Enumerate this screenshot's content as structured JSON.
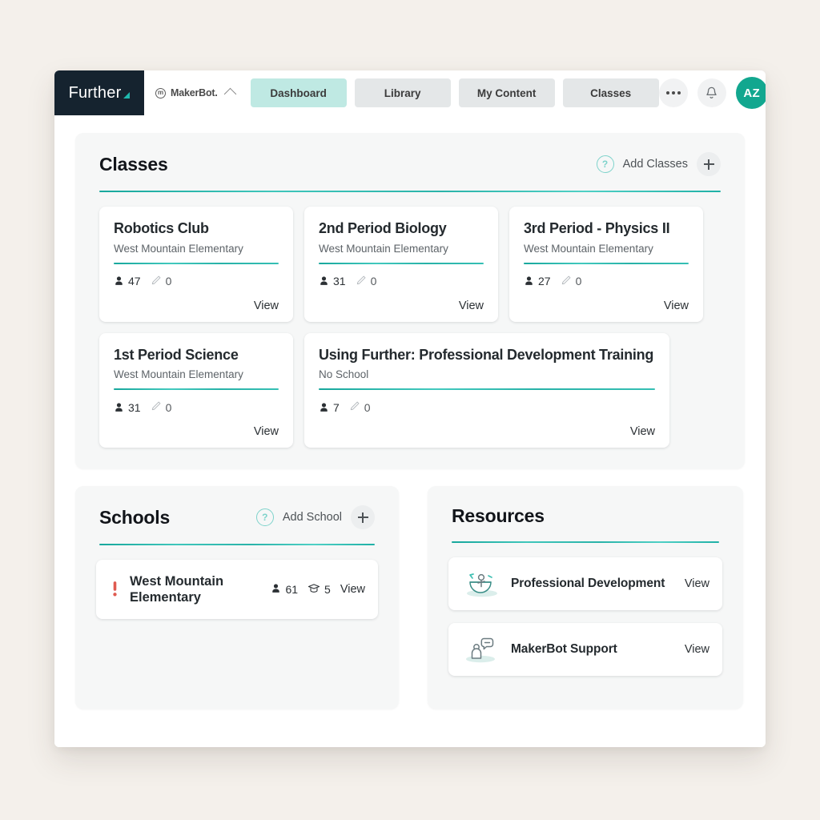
{
  "topnav": {
    "brand": "Further",
    "org": {
      "mark": "m",
      "name": "MakerBot.",
      "chevron": "chevron-up-icon"
    },
    "tabs": [
      {
        "label": "Dashboard",
        "active": true
      },
      {
        "label": "Library",
        "active": false
      },
      {
        "label": "My Content",
        "active": false
      },
      {
        "label": "Classes",
        "active": false
      }
    ],
    "more_icon": "more-dots-icon",
    "bell_icon": "bell-icon",
    "avatar_initials": "AZ"
  },
  "classes": {
    "title": "Classes",
    "help": "?",
    "add_label": "Add Classes",
    "view_label": "View",
    "cards": [
      {
        "name": "Robotics Club",
        "school": "West Mountain Elementary",
        "students": "47",
        "assignments": "0",
        "view": "View"
      },
      {
        "name": "2nd Period Biology",
        "school": "West Mountain Elementary",
        "students": "31",
        "assignments": "0",
        "view": "View"
      },
      {
        "name": "3rd Period - Physics II",
        "school": "West Mountain Elementary",
        "students": "27",
        "assignments": "0",
        "view": "View"
      },
      {
        "name": "1st Period Science",
        "school": "West Mountain Elementary",
        "students": "31",
        "assignments": "0",
        "view": "View"
      },
      {
        "name": "Using Further: Professional Development Training",
        "school": "No School",
        "students": "7",
        "assignments": "0",
        "view": "View"
      }
    ]
  },
  "schools": {
    "title": "Schools",
    "help": "?",
    "add_label": "Add School",
    "items": [
      {
        "name": "West Mountain Elementary",
        "students": "61",
        "teachers": "5",
        "view": "View",
        "alert": "alert-icon"
      }
    ]
  },
  "resources": {
    "title": "Resources",
    "items": [
      {
        "label": "Professional Development",
        "view": "View",
        "illustration": "professional-development-illustration"
      },
      {
        "label": "MakerBot Support",
        "view": "View",
        "illustration": "support-chat-illustration"
      }
    ]
  },
  "colors": {
    "brand_dark": "#15232f",
    "teal": "#1fb8ae",
    "accent_tab": "#bfe9e3",
    "avatar": "#12a78f",
    "alert_red": "#e0544b",
    "page_bg": "#f4f0eb"
  }
}
